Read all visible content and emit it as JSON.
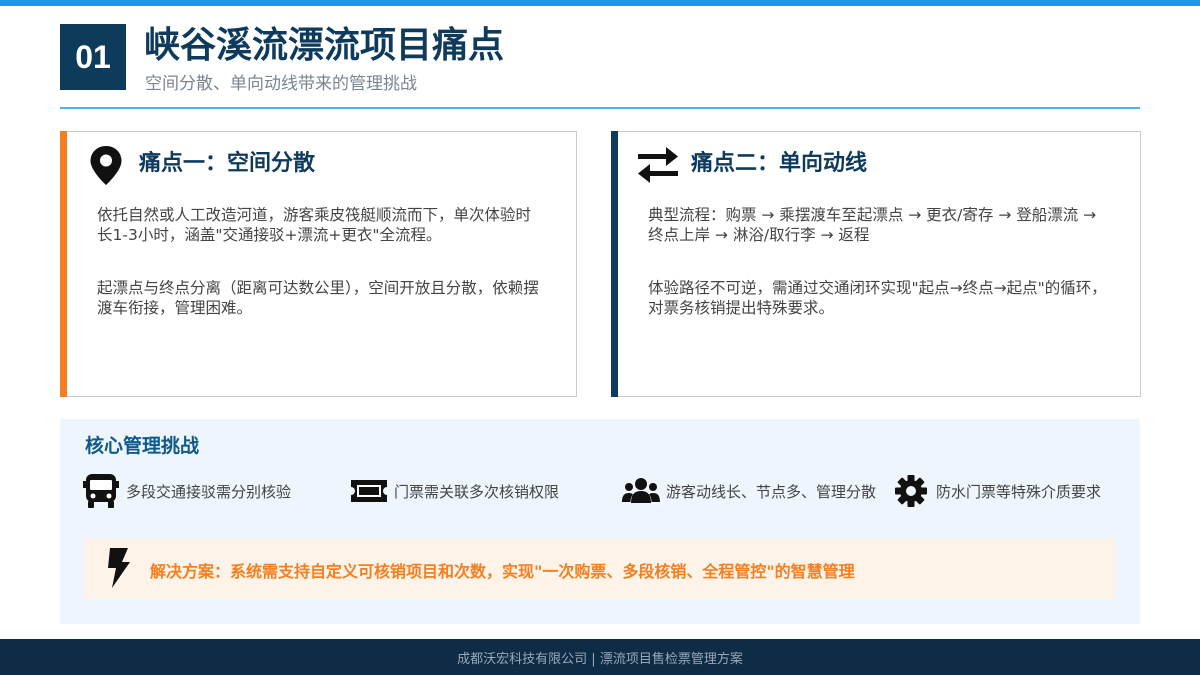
{
  "header": {
    "number": "01",
    "title": "峡谷溪流漂流项目痛点",
    "subtitle": "空间分散、单向动线带来的管理挑战"
  },
  "pain_points": [
    {
      "icon": "map-pin-icon",
      "title": "痛点一：空间分散",
      "paragraphs": [
        "依托自然或人工改造河道，游客乘皮筏艇顺流而下，单次体验时长1-3小时，涵盖\"交通接驳+漂流+更衣\"全流程。",
        "起漂点与终点分离（距离可达数公里），空间开放且分散，依赖摆渡车衔接，管理困难。"
      ]
    },
    {
      "icon": "swap-arrows-icon",
      "title": "痛点二：单向动线",
      "paragraphs": [
        "典型流程：购票 → 乘摆渡车至起漂点 → 更衣/寄存 → 登船漂流 → 终点上岸 → 淋浴/取行李 → 返程",
        "体验路径不可逆，需通过交通闭环实现\"起点→终点→起点\"的循环，对票务核销提出特殊要求。"
      ]
    }
  ],
  "core": {
    "title": "核心管理挑战",
    "items": [
      {
        "icon": "bus-icon",
        "text": "多段交通接驳需分别核验"
      },
      {
        "icon": "ticket-icon",
        "text": "门票需关联多次核销权限"
      },
      {
        "icon": "users-icon",
        "text": "游客动线长、节点多、管理分散"
      },
      {
        "icon": "gear-icon",
        "text": "防水门票等特殊介质要求"
      }
    ],
    "solution": {
      "icon": "lightning-icon",
      "text": "解决方案：系统需支持自定义可核销项目和次数，实现\"一次购票、多段核销、全程管控\"的智慧管理"
    }
  },
  "footer": {
    "text": "成都沃宏科技有限公司 | 漂流项目售检票管理方案"
  },
  "colors": {
    "navy": "#0e3a5c",
    "accent_blue": "#1a9be0",
    "orange": "#f47f20",
    "panel_bg": "#eef5fc",
    "solution_bg": "#fdf3e8",
    "footer_bg": "#0e2c45"
  }
}
